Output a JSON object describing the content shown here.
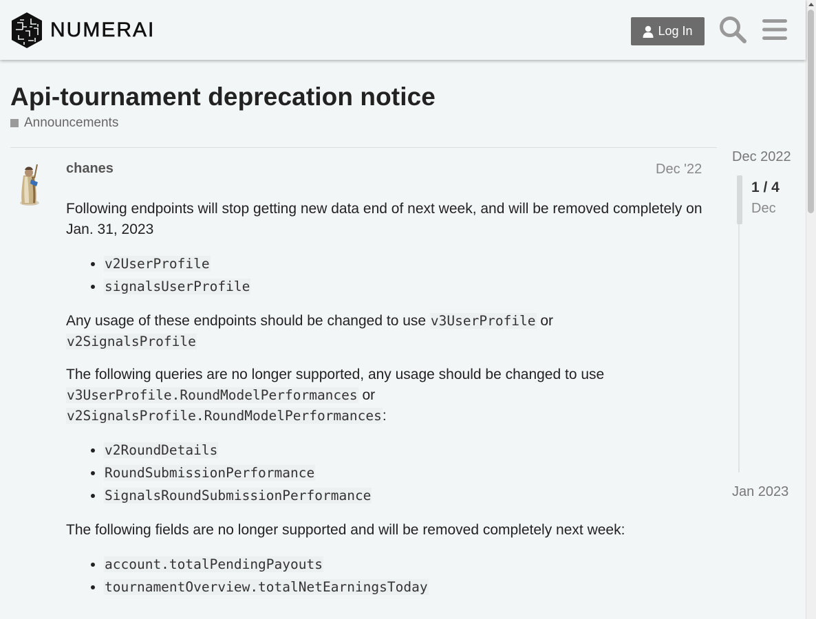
{
  "header": {
    "brand": "NUMERAI",
    "login_label": "Log In",
    "icons": [
      "user-icon",
      "search-icon",
      "hamburger-menu-icon"
    ]
  },
  "topic": {
    "title": "Api-tournament deprecation notice",
    "category": "Announcements",
    "category_color": "#9a9a9a"
  },
  "post": {
    "username": "chanes",
    "date": "Dec '22",
    "p1": "Following endpoints will stop getting new data end of next week, and will be removed completely on Jan. 31, 2023",
    "list1": [
      "v2UserProfile",
      "signalsUserProfile"
    ],
    "p2_text": "Any usage of these endpoints should be changed to use ",
    "p2_code1": "v3UserProfile",
    "p2_or": " or ",
    "p2_code2": "v2SignalsProfile",
    "p3_text": "The following queries are no longer supported, any usage should be changed to use ",
    "p3_code1": "v3UserProfile.RoundModelPerformances",
    "p3_or": " or ",
    "p3_code2": "v2SignalsProfile.RoundModelPerformances",
    "p3_end": ":",
    "list2": [
      "v2RoundDetails",
      "RoundSubmissionPerformance",
      "SignalsRoundSubmissionPerformance"
    ],
    "p4": "The following fields are no longer supported and will be removed completely next week:",
    "list3": [
      "account.totalPendingPayouts",
      "tournamentOverview.totalNetEarningsToday"
    ]
  },
  "timeline": {
    "start": "Dec 2022",
    "position": "1 / 4",
    "position_date": "Dec",
    "end": "Jan 2023"
  },
  "colors": {
    "background": "#f3f6f6",
    "button": "#6c6c6c",
    "text": "#222222",
    "muted": "#888888"
  }
}
